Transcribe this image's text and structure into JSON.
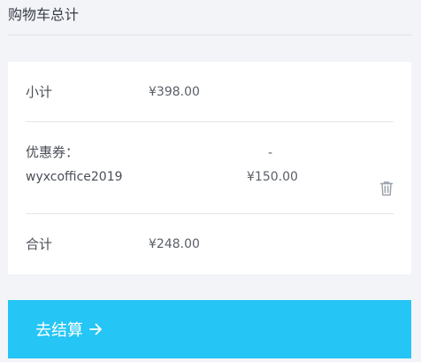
{
  "header": {
    "title": "购物车总计"
  },
  "summary": {
    "subtotal_label": "小计",
    "subtotal_value": "¥398.00",
    "coupon_label": "优惠券：",
    "coupon_code": "wyxcoffice2019",
    "coupon_sign": "-",
    "coupon_value": "¥150.00",
    "total_label": "合计",
    "total_value": "¥248.00"
  },
  "actions": {
    "checkout_label": "去结算",
    "checkout_icon": "arrow-right-icon",
    "remove_coupon_icon": "trash-icon"
  },
  "colors": {
    "accent": "#25c5f6",
    "background": "#f3f4f8",
    "card": "#ffffff"
  }
}
